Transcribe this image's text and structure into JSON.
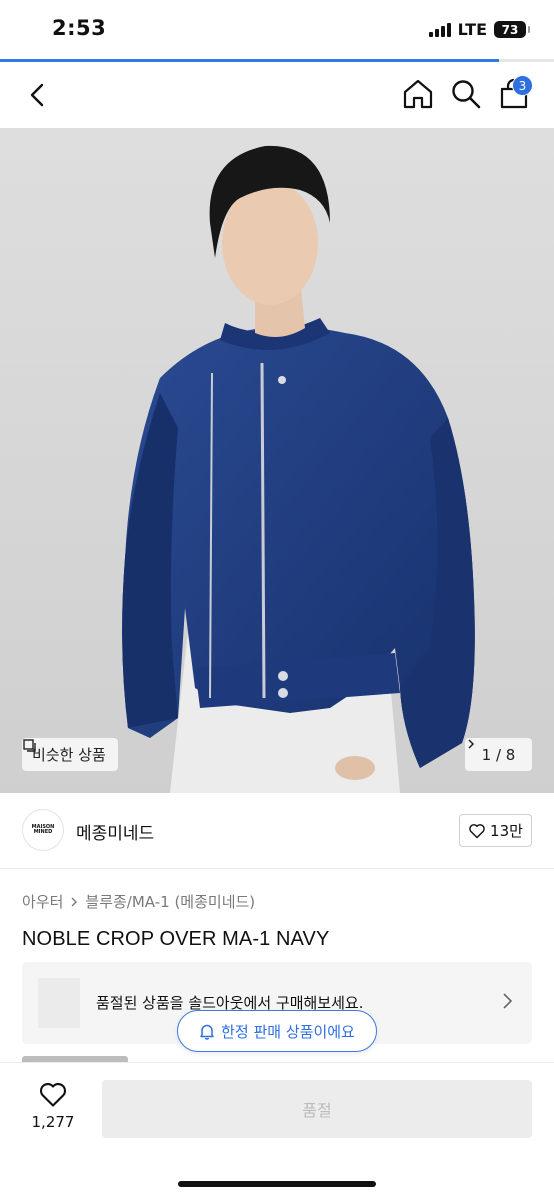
{
  "status_bar": {
    "time": "2:53",
    "network": "LTE",
    "battery": "73"
  },
  "load_progress_fraction": 0.9,
  "nav": {
    "cart_count": "3",
    "icons": [
      "chevron-left-icon",
      "home-icon",
      "search-icon",
      "shopping-bag-icon"
    ]
  },
  "gallery": {
    "similar_label": "비슷한 상품",
    "page_current": "1",
    "page_total": "8",
    "page_text": "1 / 8",
    "colors": {
      "background": "#d9d9d9",
      "jacket": "#1f3b7c"
    }
  },
  "brand": {
    "logo_text": "MAISON MINED",
    "name": "메종미네드",
    "likes": "13만"
  },
  "product": {
    "category": "아우터",
    "subcategory": "블루종/MA-1 (메종미네드)",
    "title": "NOBLE CROP OVER MA-1 NAVY"
  },
  "soldout_banner": {
    "text": "품절된 상품을 솔드아웃에서 구매해보세요."
  },
  "limited_notice": {
    "text": "한정 판매 상품이에요"
  },
  "bottom_bar": {
    "wish_count": "1,277",
    "buy_label": "품절"
  },
  "colors": {
    "accent": "#2f6fe0",
    "disabled_button": "#ececec",
    "disabled_text": "#bcbcbc"
  }
}
